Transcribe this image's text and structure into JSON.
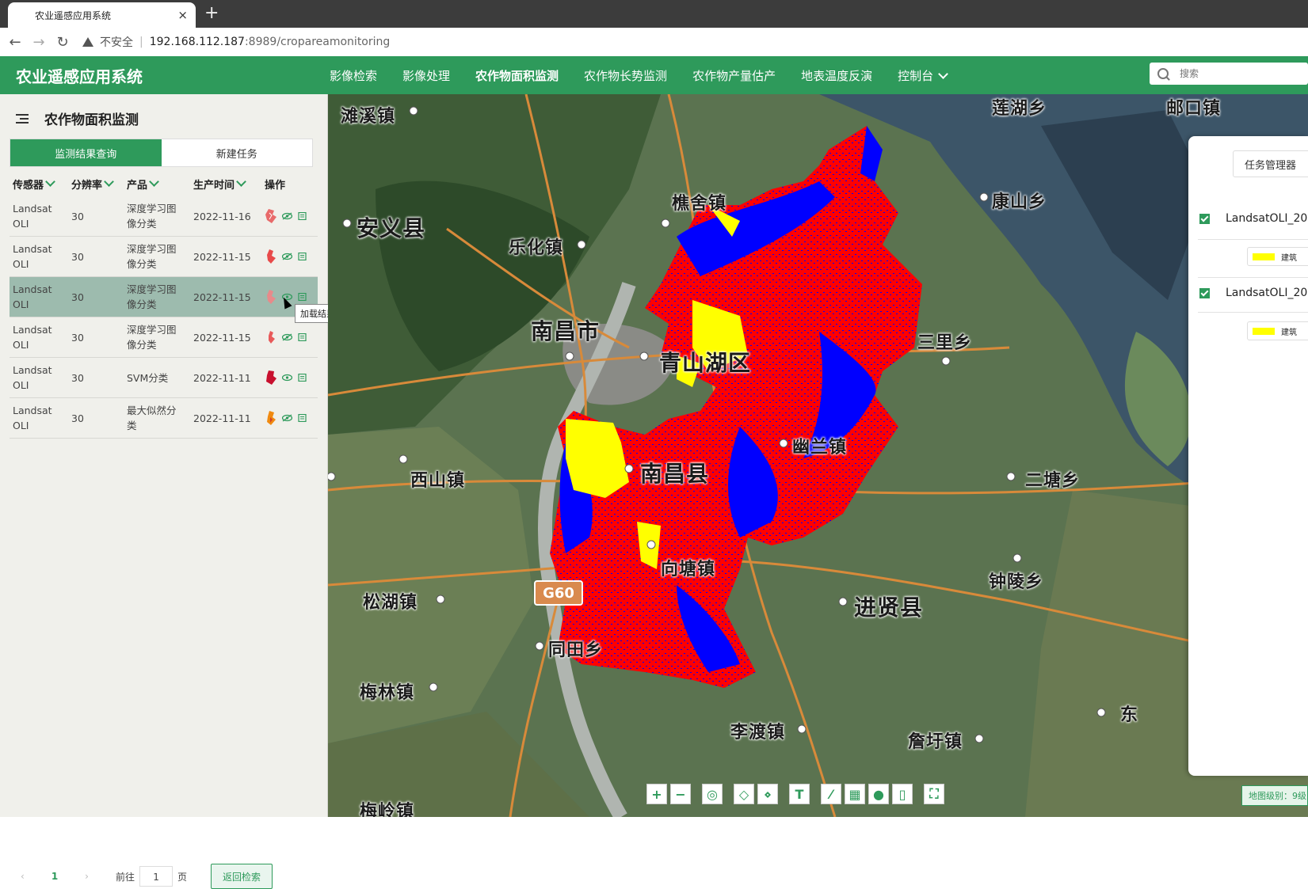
{
  "browser": {
    "tab_title": "农业遥感应用系统",
    "tab_close": "×",
    "new_tab": "+",
    "insecure_label": "不安全",
    "url_host": "192.168.112.187",
    "url_rest": ":8989/cropareamonitoring"
  },
  "header": {
    "brand": "农业遥感应用系统",
    "menu": [
      "影像检索",
      "影像处理",
      "农作物面积监测",
      "农作物长势监测",
      "农作物产量估产",
      "地表温度反演",
      "控制台"
    ],
    "active_menu": "农作物面积监测",
    "search_placeholder": "搜索"
  },
  "left_panel": {
    "title": "农作物面积监测",
    "tabs": [
      "监测结果查询",
      "新建任务"
    ],
    "columns": [
      "传感器",
      "分辨率",
      "产品",
      "生产时间",
      "操作"
    ],
    "rows": [
      {
        "sensor1": "Landsat",
        "sensor2": "OLI",
        "resolution": "30",
        "product1": "深度学习图",
        "product2": "像分类",
        "date": "2022-11-16"
      },
      {
        "sensor1": "Landsat",
        "sensor2": "OLI",
        "resolution": "30",
        "product1": "深度学习图",
        "product2": "像分类",
        "date": "2022-11-15"
      },
      {
        "sensor1": "Landsat",
        "sensor2": "OLI",
        "resolution": "30",
        "product1": "深度学习图",
        "product2": "像分类",
        "date": "2022-11-15"
      },
      {
        "sensor1": "Landsat",
        "sensor2": "OLI",
        "resolution": "30",
        "product1": "深度学习图",
        "product2": "像分类",
        "date": "2022-11-15"
      },
      {
        "sensor1": "Landsat",
        "sensor2": "OLI",
        "resolution": "30",
        "product1": "SVM分类",
        "product2": "",
        "date": "2022-11-11"
      },
      {
        "sensor1": "Landsat",
        "sensor2": "OLI",
        "resolution": "30",
        "product1": "最大似然分",
        "product2": "类",
        "date": "2022-11-11"
      }
    ],
    "tooltip": "加载结果数据",
    "pager": {
      "current": "1",
      "prev": "‹",
      "next": "›",
      "goto_label": "前往",
      "goto_value": "1",
      "page_label": "页",
      "back_button": "返回检索"
    }
  },
  "map": {
    "labels": {
      "l1": "滩溪镇",
      "l2": "莲湖乡",
      "l3": "安义县",
      "l4": "樵舍镇",
      "l5": "康山乡",
      "l6": "乐化镇",
      "l7": "南昌市",
      "l8": "青山湖区",
      "l9": "三里乡",
      "l10": "西山镇",
      "l11": "南昌县",
      "l12": "幽兰镇",
      "l13": "二塘乡",
      "l14": "向塘镇",
      "l15": "钟陵乡",
      "l16": "松湖镇",
      "l17": "进贤县",
      "l18": "同田乡",
      "l19": "梅林镇",
      "l20": "李渡镇",
      "l21": "詹圩镇",
      "l22": "梅岭镇",
      "l23": "邮口镇",
      "l24": "东"
    },
    "highway": "G60",
    "zoom_level": "地图级别：9级",
    "toolbar": [
      "zoom-in",
      "zoom-out",
      "globe",
      "eraser",
      "brush",
      "text",
      "measure-line",
      "measure-area",
      "marker",
      "delete",
      "fullscreen"
    ],
    "colors": {
      "class_red": "#ff0000",
      "class_blue": "#0000ff",
      "class_yellow": "#ffff00",
      "brand_green": "#2e9a5b"
    }
  },
  "right_panel": {
    "task_manager": "任务管理器",
    "layers": [
      {
        "name": "LandsatOLI_20",
        "legend": "建筑"
      },
      {
        "name": "LandsatOLI_20",
        "legend": "建筑"
      }
    ]
  }
}
